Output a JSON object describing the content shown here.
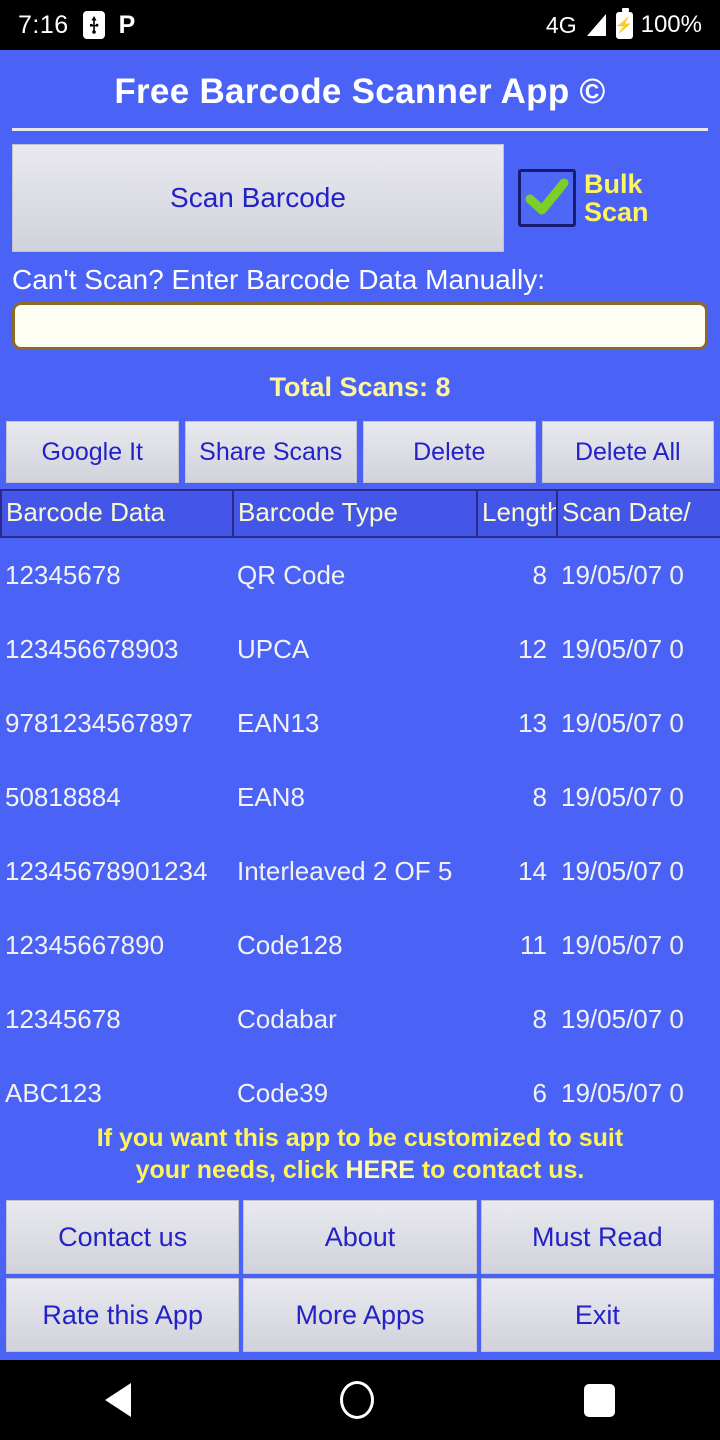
{
  "status_bar": {
    "time": "7:16",
    "usb_icon": "usb-icon",
    "p_icon": "P",
    "network": "4G",
    "signal_icon": "signal-bars-icon",
    "battery_icon": "battery-charging-icon",
    "battery_percent": "100%"
  },
  "app": {
    "title": "Free Barcode Scanner App ©",
    "scan_button": "Scan Barcode",
    "bulk_scan_label": "Bulk\nScan",
    "bulk_scan_label_line1": "Bulk",
    "bulk_scan_label_line2": "Scan",
    "bulk_scan_checked": true,
    "manual_label": "Can't Scan? Enter Barcode Data Manually:",
    "manual_input_value": "",
    "manual_input_placeholder": "",
    "total_scans": "Total Scans: 8"
  },
  "actions": [
    {
      "label": "Google It"
    },
    {
      "label": "Share Scans"
    },
    {
      "label": "Delete"
    },
    {
      "label": "Delete All"
    }
  ],
  "table": {
    "headers": [
      "Barcode Data",
      "Barcode Type",
      "Length",
      "Scan Date/"
    ],
    "rows": [
      {
        "data": "12345678",
        "type": "QR Code",
        "length": "8",
        "date": "19/05/07 0"
      },
      {
        "data": "123456678903",
        "type": "UPCA",
        "length": "12",
        "date": "19/05/07 0"
      },
      {
        "data": "9781234567897",
        "type": "EAN13",
        "length": "13",
        "date": "19/05/07 0"
      },
      {
        "data": "50818884",
        "type": "EAN8",
        "length": "8",
        "date": "19/05/07 0"
      },
      {
        "data": "12345678901234",
        "type": "Interleaved 2 OF 5",
        "length": "14",
        "date": "19/05/07 0"
      },
      {
        "data": "12345667890",
        "type": "Code128",
        "length": "11",
        "date": "19/05/07 0"
      },
      {
        "data": "12345678",
        "type": "Codabar",
        "length": "8",
        "date": "19/05/07 0"
      },
      {
        "data": "ABC123",
        "type": "Code39",
        "length": "6",
        "date": "19/05/07 0"
      }
    ]
  },
  "promo": {
    "line1": "If you want this app to be customized to suit",
    "line2_before": "your needs, click ",
    "line2_link": "HERE",
    "line2_after": " to contact us."
  },
  "bottom_buttons": [
    {
      "label": "Contact us"
    },
    {
      "label": "About"
    },
    {
      "label": "Must Read"
    },
    {
      "label": "Rate this App"
    },
    {
      "label": "More Apps"
    },
    {
      "label": "Exit"
    }
  ],
  "nav_bar": {
    "back": "back-icon",
    "home": "home-icon",
    "recents": "recents-icon"
  },
  "colors": {
    "app_background": "#4A62F5",
    "title_text": "#FFFFFF",
    "accent_yellow": "#FFF45C",
    "pale_yellow": "#FFF69B",
    "button_text_blue": "#2222C8",
    "button_face": "#DCDCE4",
    "table_header_bg": "#4356E8",
    "table_header_text": "#FAFAD0",
    "input_border": "#8D6A2A",
    "input_fill": "#FFFEF3",
    "check_green": "#7AD026",
    "status_bar_bg": "#000000"
  }
}
